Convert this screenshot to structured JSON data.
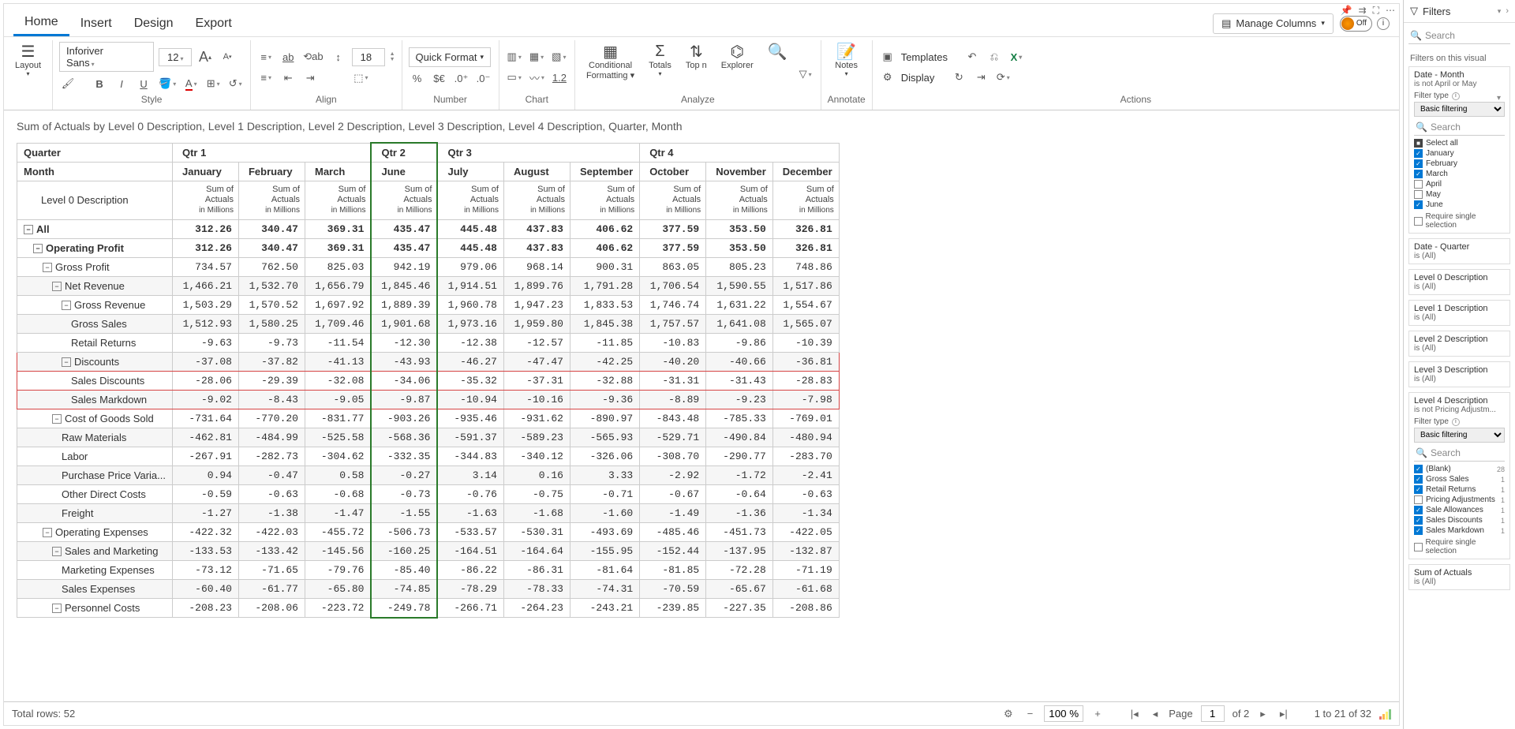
{
  "menu": {
    "tabs": [
      "Home",
      "Insert",
      "Design",
      "Export"
    ],
    "active": 0,
    "manage_cols": "Manage Columns",
    "toggle_off": "Off"
  },
  "ribbon": {
    "layout": "Layout",
    "style": {
      "font": "Inforiver Sans",
      "size": "12",
      "group": "Style"
    },
    "align": {
      "size": "18",
      "group": "Align"
    },
    "number": {
      "quick": "Quick Format",
      "group": "Number",
      "val10": "1.2"
    },
    "chart": {
      "group": "Chart"
    },
    "analyze": {
      "cond": "Conditional",
      "fmt": "Formatting",
      "totals": "Totals",
      "topn": "Top n",
      "explorer": "Explorer",
      "group": "Analyze"
    },
    "annotate": {
      "notes": "Notes",
      "group": "Annotate"
    },
    "actions": {
      "templates": "Templates",
      "display": "Display",
      "group": "Actions"
    }
  },
  "title": "Sum of Actuals by Level 0 Description, Level 1 Description, Level 2 Description, Level 3 Description, Level 4 Description, Quarter, Month",
  "table": {
    "quarter_label": "Quarter",
    "month_label": "Month",
    "lvl0_label": "Level 0 Description",
    "measure_l1": "Sum of",
    "measure_l2": "Actuals",
    "measure_l3": "in Millions",
    "quarters": [
      {
        "name": "Qtr 1",
        "months": [
          "January",
          "February",
          "March"
        ]
      },
      {
        "name": "Qtr 2",
        "months": [
          "June"
        ]
      },
      {
        "name": "Qtr 3",
        "months": [
          "July",
          "August",
          "September"
        ]
      },
      {
        "name": "Qtr 4",
        "months": [
          "October",
          "November",
          "December"
        ]
      }
    ],
    "rows": [
      {
        "label": "All",
        "lvl": 0,
        "exp": true,
        "bold": true,
        "v": [
          "312.26",
          "340.47",
          "369.31",
          "435.47",
          "445.48",
          "437.83",
          "406.62",
          "377.59",
          "353.50",
          "326.81"
        ]
      },
      {
        "label": "Operating Profit",
        "lvl": 1,
        "exp": true,
        "bold": true,
        "v": [
          "312.26",
          "340.47",
          "369.31",
          "435.47",
          "445.48",
          "437.83",
          "406.62",
          "377.59",
          "353.50",
          "326.81"
        ]
      },
      {
        "label": "Gross Profit",
        "lvl": 2,
        "exp": true,
        "v": [
          "734.57",
          "762.50",
          "825.03",
          "942.19",
          "979.06",
          "968.14",
          "900.31",
          "863.05",
          "805.23",
          "748.86"
        ]
      },
      {
        "label": "Net Revenue",
        "lvl": 3,
        "exp": true,
        "alt": true,
        "v": [
          "1,466.21",
          "1,532.70",
          "1,656.79",
          "1,845.46",
          "1,914.51",
          "1,899.76",
          "1,791.28",
          "1,706.54",
          "1,590.55",
          "1,517.86"
        ]
      },
      {
        "label": "Gross Revenue",
        "lvl": 4,
        "exp": true,
        "v": [
          "1,503.29",
          "1,570.52",
          "1,697.92",
          "1,889.39",
          "1,960.78",
          "1,947.23",
          "1,833.53",
          "1,746.74",
          "1,631.22",
          "1,554.67"
        ]
      },
      {
        "label": "Gross Sales",
        "lvl": 5,
        "alt": true,
        "v": [
          "1,512.93",
          "1,580.25",
          "1,709.46",
          "1,901.68",
          "1,973.16",
          "1,959.80",
          "1,845.38",
          "1,757.57",
          "1,641.08",
          "1,565.07"
        ]
      },
      {
        "label": "Retail Returns",
        "lvl": 5,
        "v": [
          "-9.63",
          "-9.73",
          "-11.54",
          "-12.30",
          "-12.38",
          "-12.57",
          "-11.85",
          "-10.83",
          "-9.86",
          "-10.39"
        ]
      },
      {
        "label": "Discounts",
        "lvl": 4,
        "exp": true,
        "red": true,
        "alt": true,
        "v": [
          "-37.08",
          "-37.82",
          "-41.13",
          "-43.93",
          "-46.27",
          "-47.47",
          "-42.25",
          "-40.20",
          "-40.66",
          "-36.81"
        ]
      },
      {
        "label": "Sales Discounts",
        "lvl": 5,
        "red": true,
        "v": [
          "-28.06",
          "-29.39",
          "-32.08",
          "-34.06",
          "-35.32",
          "-37.31",
          "-32.88",
          "-31.31",
          "-31.43",
          "-28.83"
        ]
      },
      {
        "label": "Sales Markdown",
        "lvl": 5,
        "red": true,
        "alt": true,
        "v": [
          "-9.02",
          "-8.43",
          "-9.05",
          "-9.87",
          "-10.94",
          "-10.16",
          "-9.36",
          "-8.89",
          "-9.23",
          "-7.98"
        ]
      },
      {
        "label": "Cost of Goods Sold",
        "lvl": 3,
        "exp": true,
        "v": [
          "-731.64",
          "-770.20",
          "-831.77",
          "-903.26",
          "-935.46",
          "-931.62",
          "-890.97",
          "-843.48",
          "-785.33",
          "-769.01"
        ]
      },
      {
        "label": "Raw Materials",
        "lvl": 4,
        "alt": true,
        "v": [
          "-462.81",
          "-484.99",
          "-525.58",
          "-568.36",
          "-591.37",
          "-589.23",
          "-565.93",
          "-529.71",
          "-490.84",
          "-480.94"
        ]
      },
      {
        "label": "Labor",
        "lvl": 4,
        "v": [
          "-267.91",
          "-282.73",
          "-304.62",
          "-332.35",
          "-344.83",
          "-340.12",
          "-326.06",
          "-308.70",
          "-290.77",
          "-283.70"
        ]
      },
      {
        "label": "Purchase Price Varia...",
        "lvl": 4,
        "alt": true,
        "v": [
          "0.94",
          "-0.47",
          "0.58",
          "-0.27",
          "3.14",
          "0.16",
          "3.33",
          "-2.92",
          "-1.72",
          "-2.41"
        ]
      },
      {
        "label": "Other Direct Costs",
        "lvl": 4,
        "v": [
          "-0.59",
          "-0.63",
          "-0.68",
          "-0.73",
          "-0.76",
          "-0.75",
          "-0.71",
          "-0.67",
          "-0.64",
          "-0.63"
        ]
      },
      {
        "label": "Freight",
        "lvl": 4,
        "alt": true,
        "v": [
          "-1.27",
          "-1.38",
          "-1.47",
          "-1.55",
          "-1.63",
          "-1.68",
          "-1.60",
          "-1.49",
          "-1.36",
          "-1.34"
        ]
      },
      {
        "label": "Operating Expenses",
        "lvl": 2,
        "exp": true,
        "v": [
          "-422.32",
          "-422.03",
          "-455.72",
          "-506.73",
          "-533.57",
          "-530.31",
          "-493.69",
          "-485.46",
          "-451.73",
          "-422.05"
        ]
      },
      {
        "label": "Sales and Marketing",
        "lvl": 3,
        "exp": true,
        "alt": true,
        "v": [
          "-133.53",
          "-133.42",
          "-145.56",
          "-160.25",
          "-164.51",
          "-164.64",
          "-155.95",
          "-152.44",
          "-137.95",
          "-132.87"
        ]
      },
      {
        "label": "Marketing Expenses",
        "lvl": 4,
        "v": [
          "-73.12",
          "-71.65",
          "-79.76",
          "-85.40",
          "-86.22",
          "-86.31",
          "-81.64",
          "-81.85",
          "-72.28",
          "-71.19"
        ]
      },
      {
        "label": "Sales Expenses",
        "lvl": 4,
        "alt": true,
        "v": [
          "-60.40",
          "-61.77",
          "-65.80",
          "-74.85",
          "-78.29",
          "-78.33",
          "-74.31",
          "-70.59",
          "-65.67",
          "-61.68"
        ]
      },
      {
        "label": "Personnel Costs",
        "lvl": 3,
        "exp": true,
        "v": [
          "-208.23",
          "-208.06",
          "-223.72",
          "-249.78",
          "-266.71",
          "-264.23",
          "-243.21",
          "-239.85",
          "-227.35",
          "-208.86"
        ]
      }
    ]
  },
  "footer": {
    "total_rows": "Total rows: 52",
    "zoom": "100 %",
    "page_label": "Page",
    "page_num": "1",
    "page_of": "of 2",
    "range": "1 to 21 of 32"
  },
  "filters": {
    "title": "Filters",
    "search": "Search",
    "section": "Filters on this visual",
    "require": "Require single selection",
    "filter_type": "Filter type",
    "basic": "Basic filtering",
    "cards": {
      "month": {
        "title": "Date - Month",
        "sub": "is not April or May",
        "items": [
          {
            "label": "Select all",
            "state": "all"
          },
          {
            "label": "January",
            "state": "on"
          },
          {
            "label": "February",
            "state": "on"
          },
          {
            "label": "March",
            "state": "on"
          },
          {
            "label": "April",
            "state": "off"
          },
          {
            "label": "May",
            "state": "off"
          },
          {
            "label": "June",
            "state": "on"
          }
        ]
      },
      "quarter": {
        "title": "Date - Quarter",
        "sub": "is (All)"
      },
      "l0": {
        "title": "Level 0 Description",
        "sub": "is (All)"
      },
      "l1": {
        "title": "Level 1 Description",
        "sub": "is (All)"
      },
      "l2": {
        "title": "Level 2 Description",
        "sub": "is (All)"
      },
      "l3": {
        "title": "Level 3 Description",
        "sub": "is (All)"
      },
      "l4": {
        "title": "Level 4 Description",
        "sub": "is not Pricing Adjustm...",
        "items": [
          {
            "label": "(Blank)",
            "state": "on",
            "cnt": "28"
          },
          {
            "label": "Gross Sales",
            "state": "on",
            "cnt": "1"
          },
          {
            "label": "Retail Returns",
            "state": "on",
            "cnt": "1"
          },
          {
            "label": "Pricing Adjustments",
            "state": "off",
            "cnt": "1"
          },
          {
            "label": "Sale Allowances",
            "state": "on",
            "cnt": "1"
          },
          {
            "label": "Sales Discounts",
            "state": "on",
            "cnt": "1"
          },
          {
            "label": "Sales Markdown",
            "state": "on",
            "cnt": "1"
          }
        ]
      },
      "sumact": {
        "title": "Sum of Actuals",
        "sub": "is (All)"
      }
    }
  }
}
